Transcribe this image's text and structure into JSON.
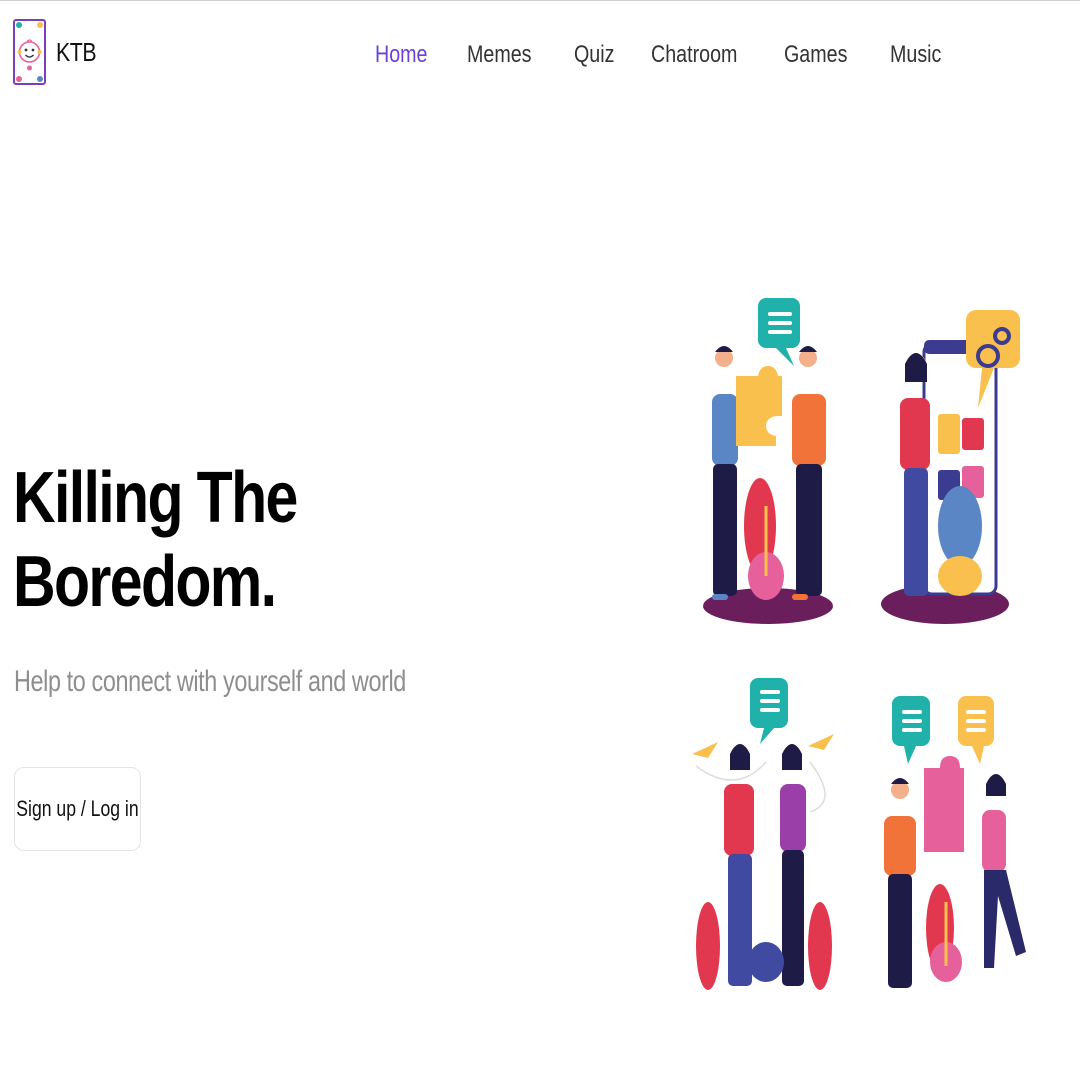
{
  "brand": {
    "name": "KTB",
    "logo_icon": "baby-face-logo-icon"
  },
  "nav": {
    "items": [
      {
        "label": "Home",
        "active": true
      },
      {
        "label": "Memes",
        "active": false
      },
      {
        "label": "Quiz",
        "active": false
      },
      {
        "label": "Chatroom",
        "active": false
      },
      {
        "label": "Games",
        "active": false
      },
      {
        "label": "Music",
        "active": false
      }
    ]
  },
  "hero": {
    "title_line1": "Killing The",
    "title_line2": "Boredom.",
    "subtitle": "Help to connect with yourself and world",
    "cta_label": "Sign up / Log in"
  },
  "illustration": {
    "icon": "people-collaboration-illustration-icon"
  },
  "colors": {
    "accent": "#6c3fd6",
    "nav_text": "#333333",
    "title": "#000000",
    "subtitle": "#8e8e8e",
    "teal": "#20b2aa",
    "yellow": "#f9c04e",
    "orange": "#f2733a",
    "pink": "#e6609c",
    "purple": "#6b1e5c",
    "navy": "#1f1b47",
    "blue": "#5b86c6"
  }
}
